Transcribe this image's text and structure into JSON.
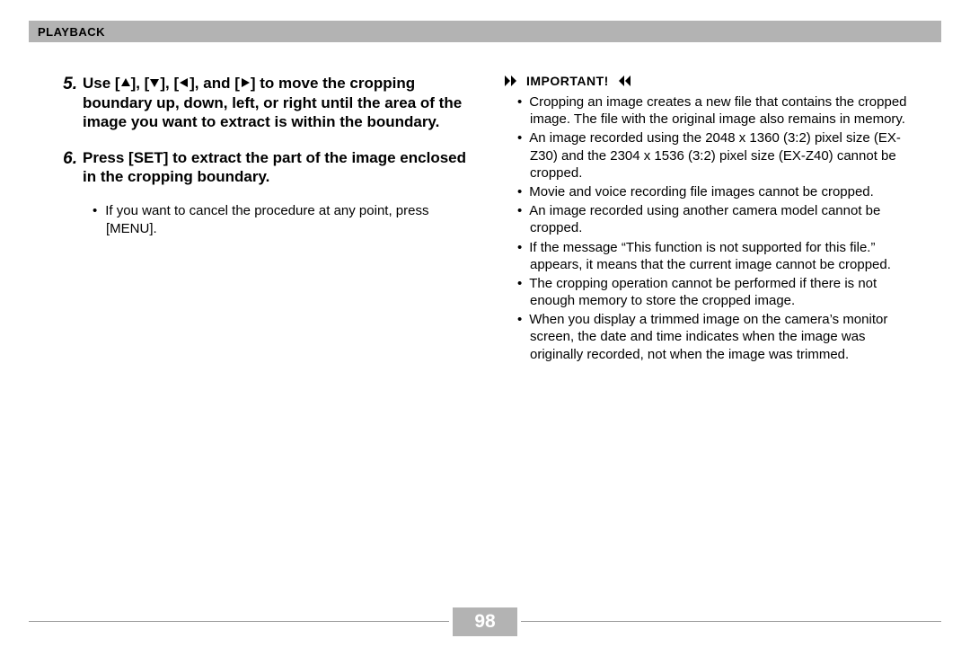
{
  "header": {
    "title": "PLAYBACK"
  },
  "left": {
    "step5": {
      "num": "5.",
      "pre": "Use [",
      "mid1": "], [",
      "mid2": "], [",
      "mid3": "], and [",
      "post": "] to move the cropping boundary up, down, left, or right until the area of the image you want to extract is within the boundary."
    },
    "step6": {
      "num": "6.",
      "text": "Press [SET] to extract the part of the image enclosed in the cropping boundary."
    },
    "sub1": "If you want to cancel the procedure at any point, press [MENU]."
  },
  "right": {
    "important_label": "IMPORTANT!",
    "bullets": [
      "Cropping an image creates a new file that contains the cropped image. The file with the original image also remains in memory.",
      "An image recorded using the 2048 x 1360 (3:2) pixel size (EX-Z30) and the 2304 x 1536 (3:2) pixel size (EX-Z40) cannot be cropped.",
      "Movie and voice recording file images cannot be cropped.",
      "An image recorded using another camera model cannot be cropped.",
      "If the message “This function is not supported for this file.” appears, it means that the current image cannot be cropped.",
      "The cropping operation cannot be performed if there is not enough memory to store the cropped image.",
      "When you display a trimmed image on the camera’s monitor screen, the date and time indicates when the image was originally recorded, not when the image was trimmed."
    ]
  },
  "page_number": "98"
}
